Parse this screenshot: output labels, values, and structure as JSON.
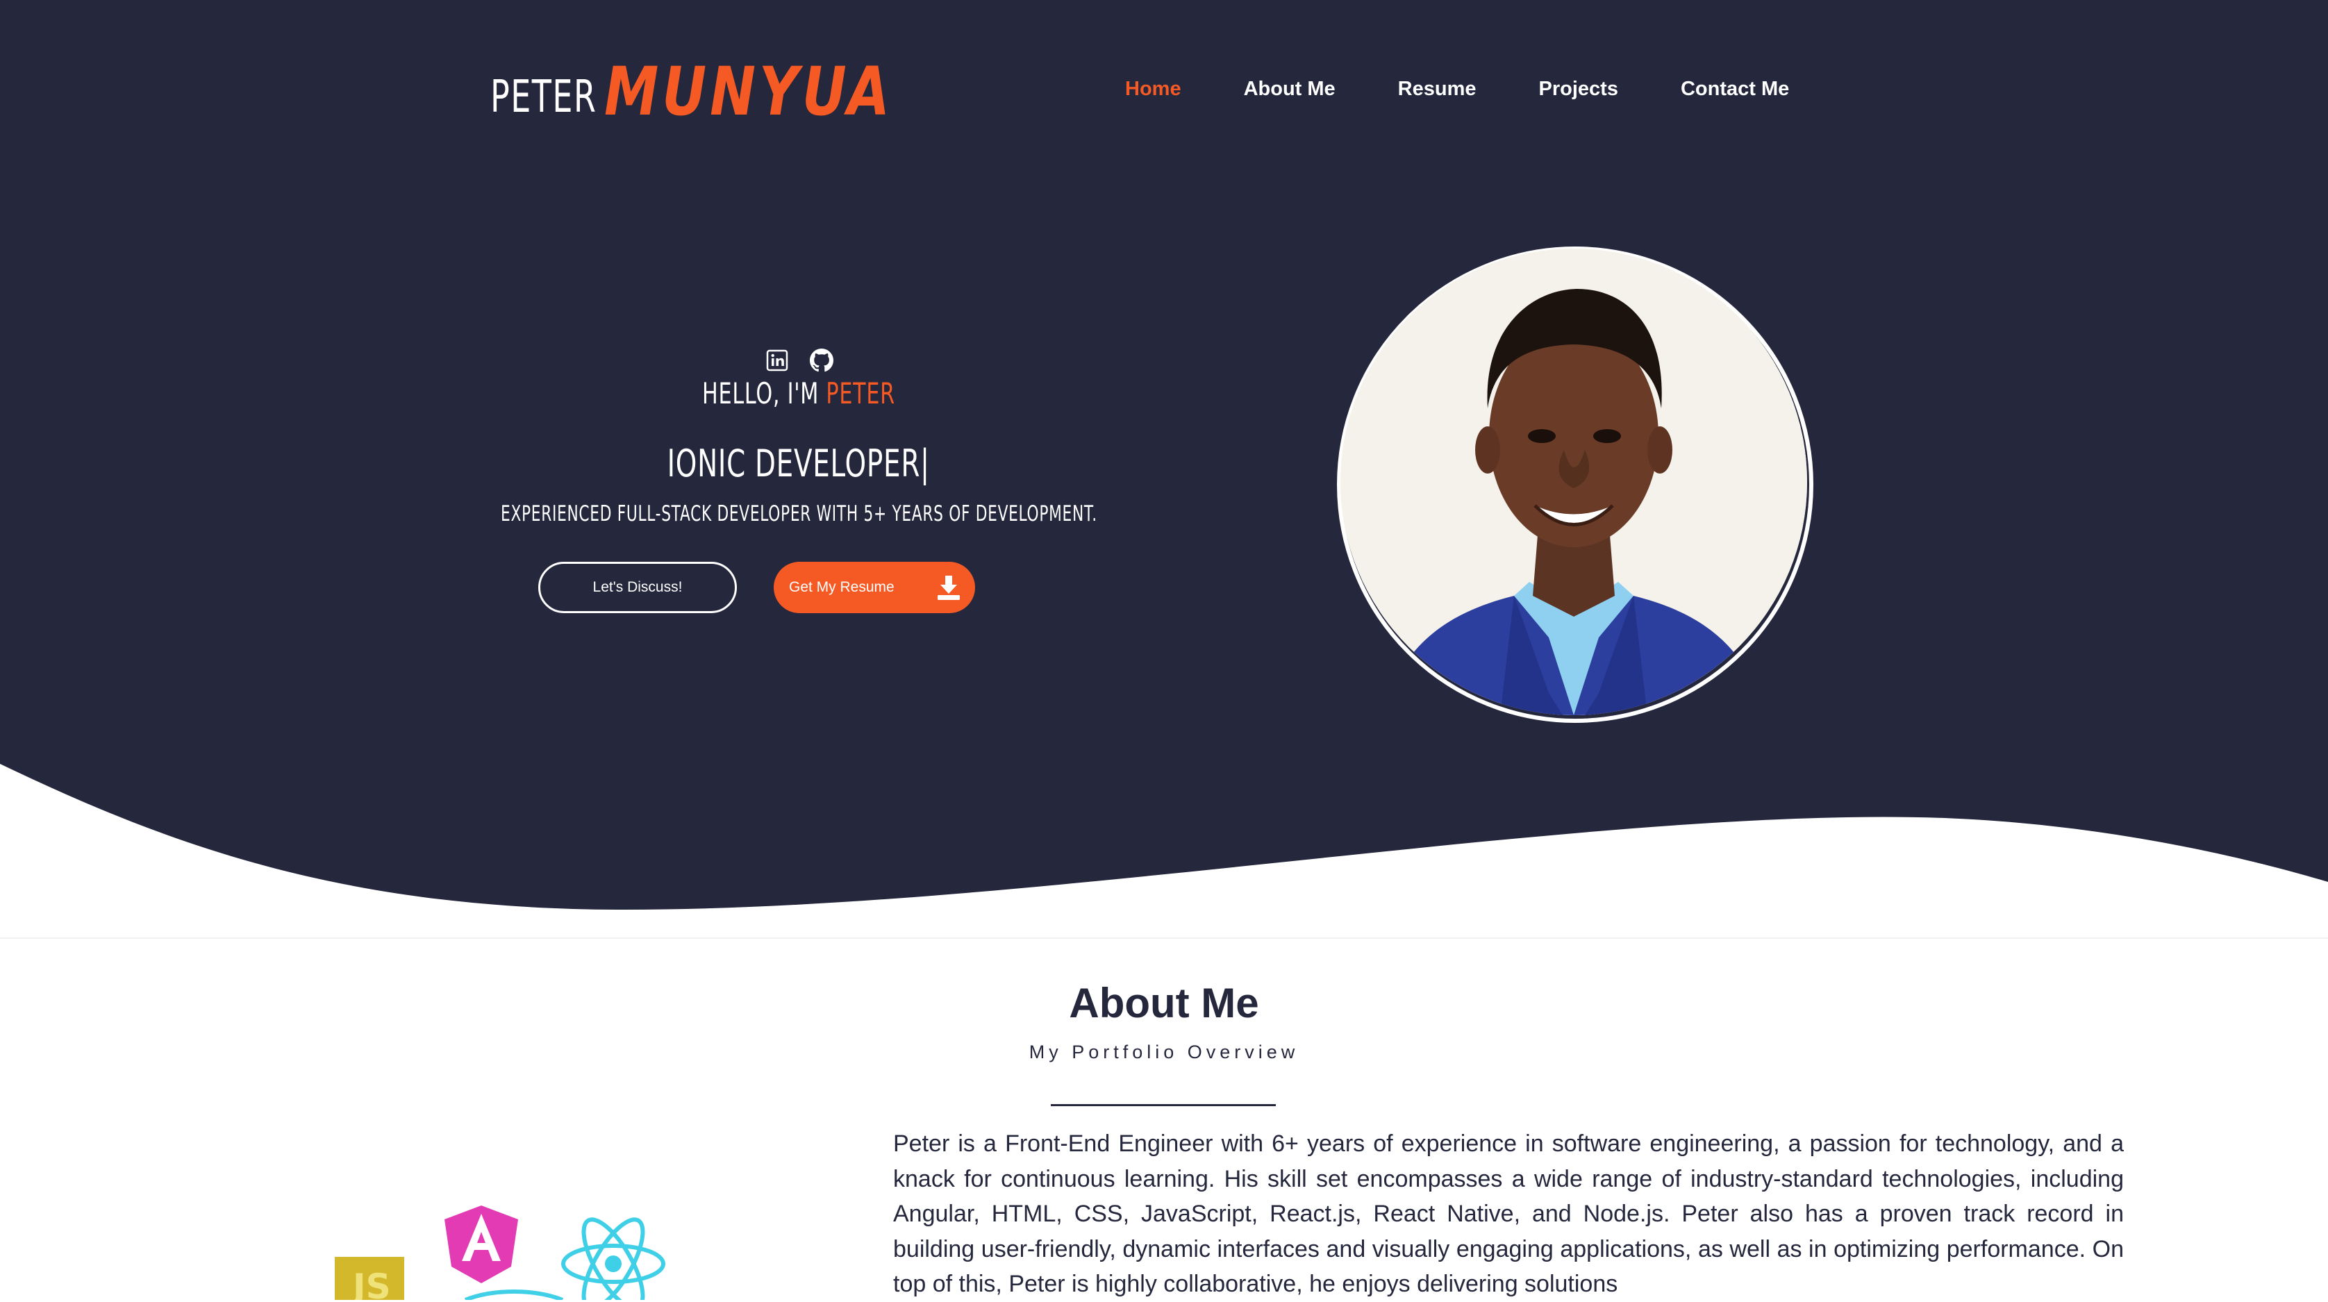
{
  "header": {
    "logo_first": "PETER",
    "logo_last": "MUNYUA",
    "nav": [
      {
        "label": "Home",
        "active": true
      },
      {
        "label": "About Me",
        "active": false
      },
      {
        "label": "Resume",
        "active": false
      },
      {
        "label": "Projects",
        "active": false
      },
      {
        "label": "Contact Me",
        "active": false
      }
    ]
  },
  "hero": {
    "socials": [
      "linkedin-icon",
      "github-icon"
    ],
    "hello_prefix": "HELLO, I'M ",
    "hello_name": "PETER",
    "role": "IONIC DEVELOPER|",
    "tagline": "EXPERIENCED FULL-STACK DEVELOPER WITH 5+ YEARS OF DEVELOPMENT.",
    "discuss_label": "Let's Discuss!",
    "resume_label": "Get My Resume"
  },
  "about": {
    "title": "About Me",
    "subtitle": "My Portfolio Overview",
    "text": "Peter is a Front-End Engineer with 6+ years of experience in software engineering, a passion for technology, and a knack for continuous learning. His skill set encompasses a wide range of industry-standard technologies, including Angular, HTML, CSS, JavaScript, React.js, React Native, and Node.js. Peter also has a proven track record in building user-friendly, dynamic interfaces and visually engaging applications, as well as in optimizing performance. On top of this, Peter is highly collaborative, he enjoys delivering solutions",
    "tech_icons": [
      "javascript-icon",
      "angular-icon",
      "react-icon"
    ]
  },
  "colors": {
    "navy": "#25273d",
    "accent": "#f55a24",
    "white": "#ffffff"
  }
}
